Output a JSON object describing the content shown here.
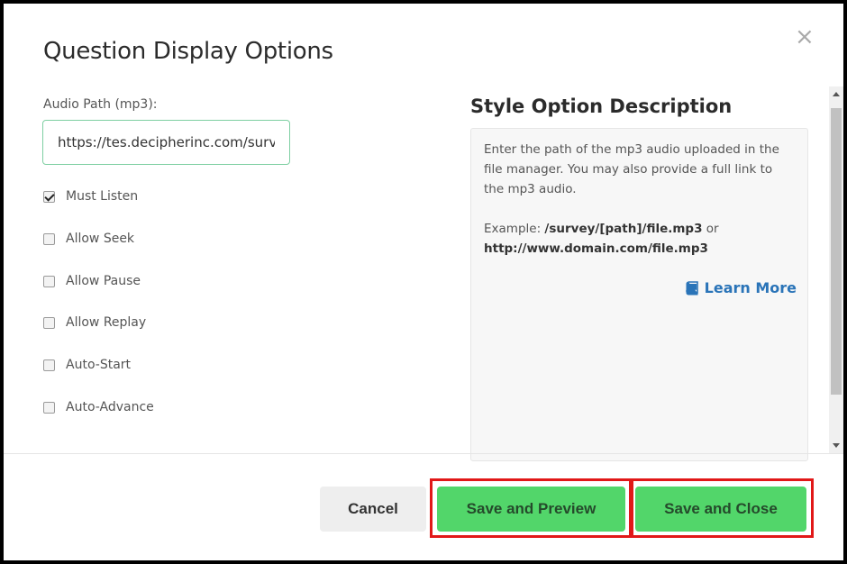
{
  "dialog": {
    "title": "Question Display Options",
    "close_glyph": "×"
  },
  "audio_path": {
    "label": "Audio Path (mp3):",
    "value": "https://tes.decipherinc.com/survey/"
  },
  "options": [
    {
      "label": "Must Listen",
      "checked": true
    },
    {
      "label": "Allow Seek",
      "checked": false
    },
    {
      "label": "Allow Pause",
      "checked": false
    },
    {
      "label": "Allow Replay",
      "checked": false
    },
    {
      "label": "Auto-Start",
      "checked": false
    },
    {
      "label": "Auto-Advance",
      "checked": false
    }
  ],
  "description": {
    "heading": "Style Option Description",
    "text": "Enter the path of the mp3 audio uploaded in the file manager. You may also provide a full link to the mp3 audio.",
    "example_prefix": "Example: ",
    "example_path": "/survey/[path]/file.mp3",
    "example_or": " or ",
    "example_url": "http://www.domain.com/file.mp3",
    "learn_more": "Learn More",
    "learn_more_icon": "book-icon"
  },
  "buttons": {
    "cancel": "Cancel",
    "save_preview": "Save and Preview",
    "save_close": "Save and Close"
  },
  "colors": {
    "save_button": "#52d66a",
    "highlight": "#e11818",
    "link": "#2a74b8"
  }
}
